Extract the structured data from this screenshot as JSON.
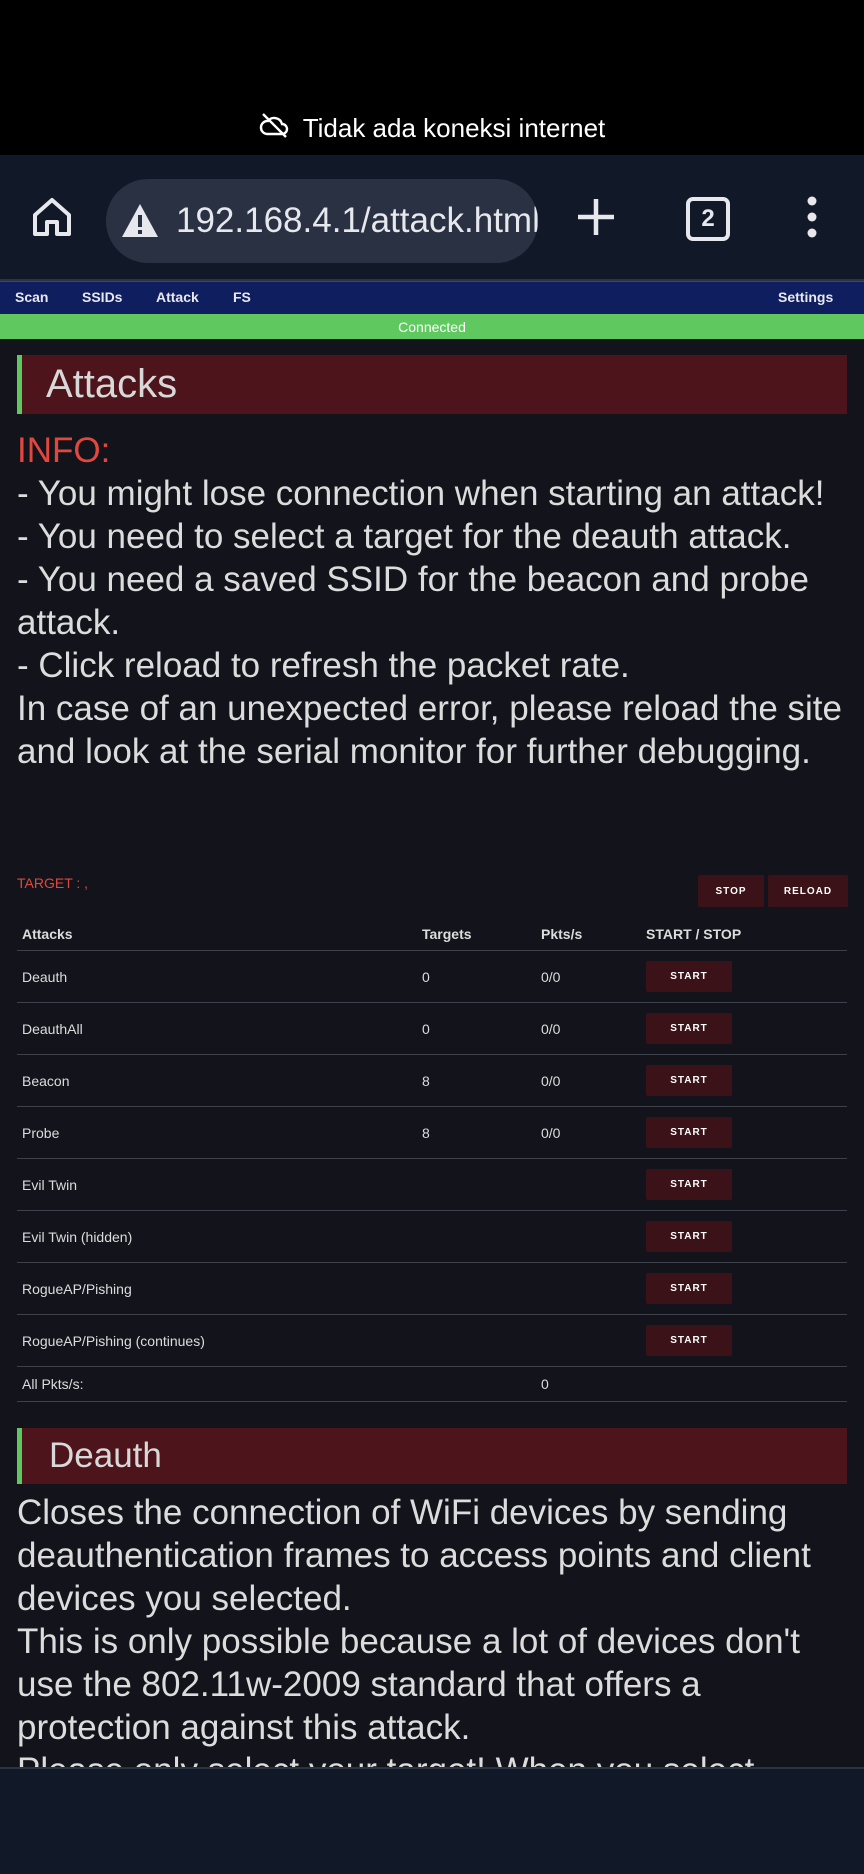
{
  "status_bar": {
    "offline_text": "Tidak ada koneksi internet",
    "icon": "cloud-off-icon"
  },
  "browser": {
    "url": "192.168.4.1/attack.html",
    "tab_count": "2",
    "icons": [
      "home-icon",
      "warning-icon",
      "plus-icon",
      "tabs-icon",
      "more-vert-icon"
    ]
  },
  "nav": {
    "items": [
      "Scan",
      "SSIDs",
      "Attack",
      "FS"
    ],
    "settings": "Settings"
  },
  "connection_status": "Connected",
  "attacks_section": {
    "title": "Attacks",
    "info_title": "INFO:",
    "info_lines": [
      "- You might lose connection when starting an attack!",
      "- You need to select a target for the deauth attack.",
      "- You need a saved SSID for the beacon and probe attack.",
      "- Click reload to refresh the packet rate.",
      "In case of an unexpected error, please reload the site and look at the serial monitor for further debugging."
    ],
    "target_label": "TARGET : ,",
    "stop_label": "STOP",
    "reload_label": "RELOAD"
  },
  "table": {
    "headers": [
      "Attacks",
      "Targets",
      "Pkts/s",
      "START / STOP"
    ],
    "rows": [
      {
        "name": "Deauth",
        "targets": "0",
        "pkts": "0/0",
        "button": "START"
      },
      {
        "name": "DeauthAll",
        "targets": "0",
        "pkts": "0/0",
        "button": "START"
      },
      {
        "name": "Beacon",
        "targets": "8",
        "pkts": "0/0",
        "button": "START"
      },
      {
        "name": "Probe",
        "targets": "8",
        "pkts": "0/0",
        "button": "START"
      },
      {
        "name": "Evil Twin",
        "targets": "",
        "pkts": "",
        "button": "START"
      },
      {
        "name": "Evil Twin (hidden)",
        "targets": "",
        "pkts": "",
        "button": "START"
      },
      {
        "name": "RogueAP/Pishing",
        "targets": "",
        "pkts": "",
        "button": "START"
      },
      {
        "name": "RogueAP/Pishing (continues)",
        "targets": "",
        "pkts": "",
        "button": "START"
      }
    ],
    "total_label": "All Pkts/s:",
    "total_value": "0"
  },
  "deauth_section": {
    "title": "Deauth",
    "lines": [
      "Closes the connection of WiFi devices by sending deauthentication frames to access points and client devices you selected.",
      "This is only possible because a lot of devices don't use the 802.11w-2009 standard that offers a protection against this attack.",
      "Please only select your target! When you select"
    ]
  },
  "colors": {
    "nav_bg": "#0f1e5e",
    "connected_green": "#5fc95f",
    "header_red": "#4d141c",
    "info_red": "#e0483e",
    "button_bg": "#3a1218",
    "page_bg": "#13141b"
  }
}
